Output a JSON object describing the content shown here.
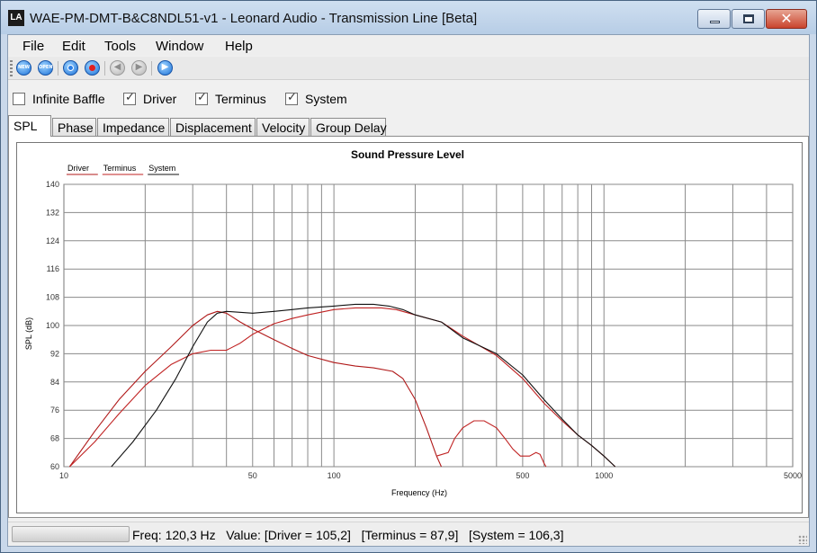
{
  "window": {
    "title": "WAE-PM-DMT-B&C8NDL51-v1 - Leonard Audio - Transmission Line [Beta]",
    "app_icon_text": "LA",
    "close_glyph": "✕"
  },
  "menu": [
    "File",
    "Edit",
    "Tools",
    "Window",
    "Help"
  ],
  "toolbar": {
    "new_label": "NEW",
    "open_label": "OPEN"
  },
  "checkboxes": [
    {
      "label": "Infinite Baffle",
      "checked": false
    },
    {
      "label": "Driver",
      "checked": true
    },
    {
      "label": "Terminus",
      "checked": true
    },
    {
      "label": "System",
      "checked": true
    }
  ],
  "tabs": [
    "SPL",
    "Phase",
    "Impedance",
    "Displacement",
    "Velocity",
    "Group Delay"
  ],
  "active_tab": "SPL",
  "status": {
    "text": "Freq: 120,3 Hz   Value: [Driver = 105,2]   [Terminus = 87,9]   [System = 106,3]"
  },
  "chart_data": {
    "type": "line",
    "title": "Sound Pressure Level",
    "xlabel": "Frequency (Hz)",
    "ylabel": "SPL (dB)",
    "xscale": "log",
    "xlim": [
      10,
      5000
    ],
    "ylim": [
      60,
      140
    ],
    "x_tick_labels": [
      10,
      50,
      100,
      500,
      1000,
      5000
    ],
    "y_ticks": [
      60,
      68,
      76,
      84,
      92,
      100,
      108,
      116,
      124,
      132,
      140
    ],
    "grid": true,
    "legend_position": "top-left",
    "legend": [
      "Driver",
      "Terminus",
      "System"
    ],
    "series": [
      {
        "name": "Driver",
        "color": "#b01818",
        "points": [
          [
            10.5,
            60
          ],
          [
            13,
            70
          ],
          [
            16,
            79
          ],
          [
            20,
            87
          ],
          [
            25,
            94
          ],
          [
            30,
            100
          ],
          [
            34,
            103
          ],
          [
            37,
            104
          ],
          [
            40,
            103.5
          ],
          [
            45,
            101
          ],
          [
            50,
            99
          ],
          [
            60,
            96
          ],
          [
            70,
            93.5
          ],
          [
            80,
            91.5
          ],
          [
            100,
            89.5
          ],
          [
            120,
            88.5
          ],
          [
            140,
            88
          ],
          [
            165,
            87
          ],
          [
            180,
            85
          ],
          [
            200,
            79
          ],
          [
            220,
            71
          ],
          [
            240,
            63
          ],
          [
            250,
            60
          ]
        ]
      },
      {
        "name": "Terminus",
        "color": "#c02222",
        "points": [
          [
            10.5,
            60
          ],
          [
            13,
            67
          ],
          [
            16,
            75
          ],
          [
            20,
            83
          ],
          [
            25,
            89
          ],
          [
            30,
            92
          ],
          [
            35,
            93
          ],
          [
            40,
            93
          ],
          [
            45,
            95
          ],
          [
            50,
            97.5
          ],
          [
            60,
            100.5
          ],
          [
            70,
            102
          ],
          [
            80,
            103
          ],
          [
            100,
            104.5
          ],
          [
            120,
            105
          ],
          [
            150,
            105
          ],
          [
            170,
            104.5
          ],
          [
            200,
            103
          ],
          [
            250,
            101
          ],
          [
            300,
            97
          ],
          [
            400,
            91.5
          ],
          [
            500,
            85
          ],
          [
            600,
            78
          ],
          [
            700,
            73
          ],
          [
            800,
            69
          ],
          [
            900,
            66
          ],
          [
            1000,
            63
          ],
          [
            1100,
            60
          ]
        ]
      },
      {
        "name": "System",
        "color": "#111111",
        "points": [
          [
            15,
            60
          ],
          [
            18,
            67
          ],
          [
            22,
            76
          ],
          [
            26,
            85
          ],
          [
            30,
            94
          ],
          [
            34,
            101
          ],
          [
            37,
            103.5
          ],
          [
            40,
            104
          ],
          [
            50,
            103.5
          ],
          [
            60,
            104
          ],
          [
            70,
            104.5
          ],
          [
            80,
            105
          ],
          [
            100,
            105.5
          ],
          [
            120,
            106
          ],
          [
            140,
            106
          ],
          [
            160,
            105.5
          ],
          [
            180,
            104.5
          ],
          [
            200,
            103
          ],
          [
            250,
            101
          ],
          [
            300,
            96.5
          ],
          [
            400,
            92
          ],
          [
            500,
            86
          ],
          [
            600,
            79
          ],
          [
            700,
            73.5
          ],
          [
            800,
            69
          ],
          [
            900,
            66
          ],
          [
            1000,
            63
          ],
          [
            1100,
            60
          ]
        ]
      }
    ],
    "terminus_notch": [
      [
        240,
        63
      ],
      [
        265,
        64
      ],
      [
        280,
        68
      ],
      [
        300,
        71
      ],
      [
        330,
        73
      ],
      [
        360,
        73
      ],
      [
        400,
        71
      ],
      [
        430,
        68
      ],
      [
        460,
        65
      ],
      [
        490,
        63
      ],
      [
        530,
        63
      ],
      [
        560,
        64
      ],
      [
        580,
        63.5
      ],
      [
        600,
        61
      ],
      [
        610,
        60
      ]
    ]
  }
}
